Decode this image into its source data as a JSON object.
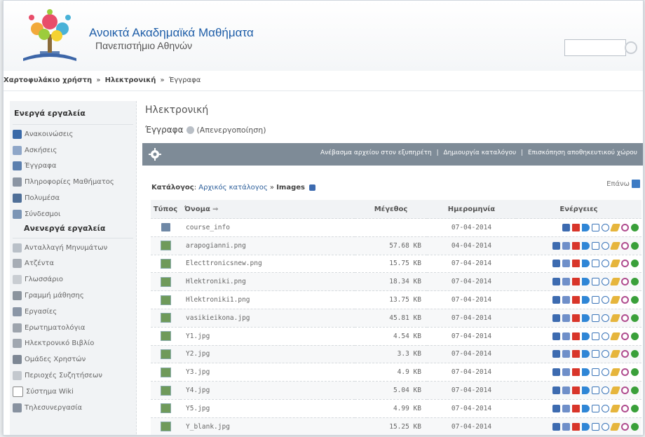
{
  "header": {
    "title": "Ανοικτά Ακαδημαϊκά Μαθήματα",
    "subtitle": "Πανεπιστήμιο Αθηνών",
    "search_placeholder": ""
  },
  "breadcrumb": {
    "items": [
      "Χαρτοφυλάκιο χρήστη",
      "Ηλεκτρονική",
      "Έγγραφα"
    ],
    "separator": "»"
  },
  "sidebar": {
    "active_header": "Ενεργά εργαλεία",
    "active_items": [
      {
        "label": "Ανακοινώσεις",
        "icon": "announcements-icon",
        "color": "#3a6aa8"
      },
      {
        "label": "Ασκήσεις",
        "icon": "exercises-icon",
        "color": "#8ea6c8"
      },
      {
        "label": "Έγγραφα",
        "icon": "documents-icon",
        "color": "#5b7fae"
      },
      {
        "label": "Πληροφορίες Μαθήματος",
        "icon": "course-info-icon",
        "color": "#8b95a3"
      },
      {
        "label": "Πολυμέσα",
        "icon": "multimedia-icon",
        "color": "#4f6f98"
      },
      {
        "label": "Σύνδεσμοι",
        "icon": "links-icon",
        "color": "#7b95b5"
      }
    ],
    "inactive_header": "Ανενεργά εργαλεία",
    "inactive_items": [
      {
        "label": "Ανταλλαγή Μηνυμάτων",
        "icon": "messages-icon",
        "color": "#b9c0c8"
      },
      {
        "label": "Ατζέντα",
        "icon": "agenda-icon",
        "color": "#a7adb5"
      },
      {
        "label": "Γλωσσάριο",
        "icon": "glossary-icon",
        "color": "#c9cdd2"
      },
      {
        "label": "Γραμμή μάθησης",
        "icon": "learning-path-icon",
        "color": "#8b949e"
      },
      {
        "label": "Εργασίες",
        "icon": "assignments-icon",
        "color": "#8a96a6"
      },
      {
        "label": "Ερωτηματολόγια",
        "icon": "questionnaires-icon",
        "color": "#9da4ad"
      },
      {
        "label": "Ηλεκτρονικό Βιβλίο",
        "icon": "ebook-icon",
        "color": "#a0a7b0"
      },
      {
        "label": "Ομάδες Χρηστών",
        "icon": "user-groups-icon",
        "color": "#7d8794"
      },
      {
        "label": "Περιοχές Συζητήσεων",
        "icon": "forum-icon",
        "color": "#c3c8ce"
      },
      {
        "label": "Σύστημα Wiki",
        "icon": "wiki-icon",
        "color": "#ffffff"
      },
      {
        "label": "Τηλεσυνεργασία",
        "icon": "teleconference-icon",
        "color": "#8892a0"
      }
    ]
  },
  "main": {
    "course_title": "Ηλεκτρονική",
    "section_title": "Έγγραφα",
    "deactivate_label": "(Απενεργοποίηση)",
    "toolbar": {
      "upload": "Ανέβασμα αρχείου στον εξυπηρέτη",
      "create_dir": "Δημιουργία καταλόγου",
      "storage": "Επισκόπηση αποθηκευτικού χώρου",
      "separator": "|"
    },
    "directory": {
      "label": "Κατάλογος",
      "root": "Αρχικός κατάλογος",
      "current": "Images",
      "sep": "»"
    },
    "up_label": "Επάνω",
    "table": {
      "headers": {
        "type": "Τύπος",
        "name": "Όνομα",
        "size": "Μέγεθος",
        "date": "Ημερομηνία",
        "actions": "Ενέργειες"
      },
      "rows": [
        {
          "kind": "folder",
          "name": "course_info",
          "size": "",
          "date": "07-04-2014"
        },
        {
          "kind": "image",
          "name": "arapogianni.png",
          "size": "57.68 KB",
          "date": "04-04-2014"
        },
        {
          "kind": "image",
          "name": "Electtronicsnew.png",
          "size": "15.75 KB",
          "date": "07-04-2014"
        },
        {
          "kind": "image",
          "name": "Hlektroniki.png",
          "size": "18.34 KB",
          "date": "07-04-2014"
        },
        {
          "kind": "image",
          "name": "Hlektroniki1.png",
          "size": "13.75 KB",
          "date": "07-04-2014"
        },
        {
          "kind": "image",
          "name": "vasikieikona.jpg",
          "size": "45.81 KB",
          "date": "07-04-2014"
        },
        {
          "kind": "image",
          "name": "Y1.jpg",
          "size": "4.54 KB",
          "date": "07-04-2014"
        },
        {
          "kind": "image",
          "name": "Y2.jpg",
          "size": "3.3 KB",
          "date": "07-04-2014"
        },
        {
          "kind": "image",
          "name": "Y3.jpg",
          "size": "4.9 KB",
          "date": "07-04-2014"
        },
        {
          "kind": "image",
          "name": "Y4.jpg",
          "size": "5.04 KB",
          "date": "07-04-2014"
        },
        {
          "kind": "image",
          "name": "Y5.jpg",
          "size": "4.99 KB",
          "date": "07-04-2014"
        },
        {
          "kind": "image",
          "name": "Y_blank.jpg",
          "size": "15.25 KB",
          "date": "07-04-2014"
        }
      ]
    }
  }
}
